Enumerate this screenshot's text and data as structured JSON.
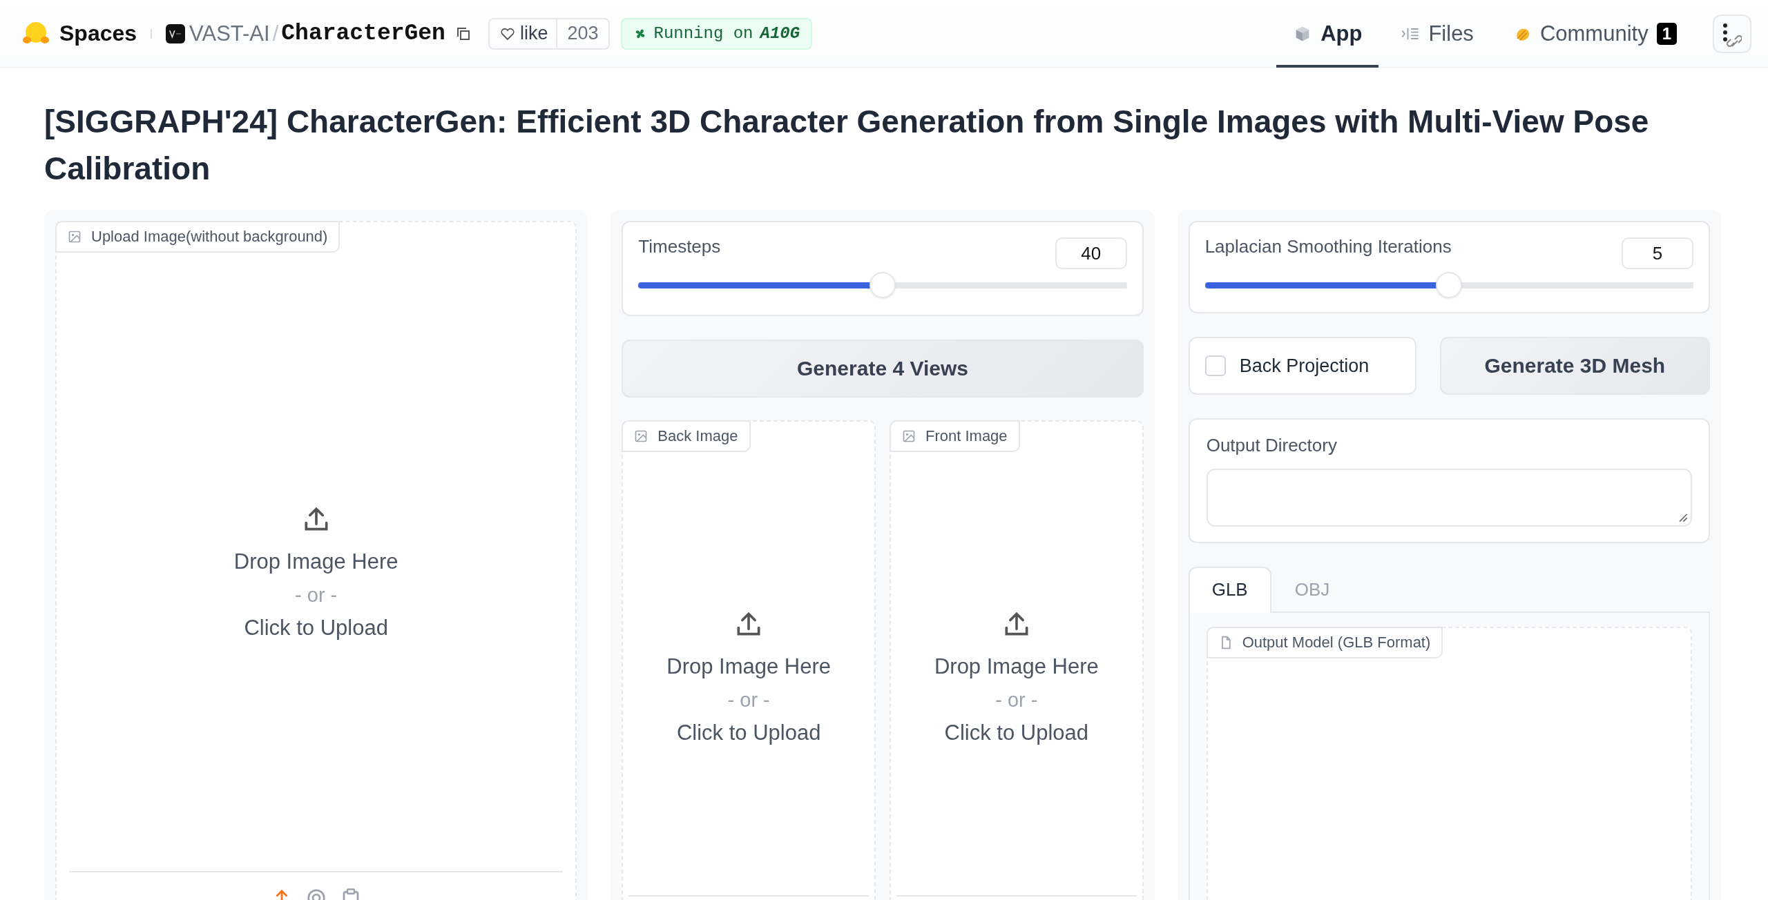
{
  "header": {
    "brand": "Spaces",
    "owner": "VAST-AI",
    "separator": "/",
    "repo": "CharacterGen",
    "like": {
      "label": "like",
      "count": "203"
    },
    "status": {
      "text": "Running on",
      "hardware": "A10G"
    },
    "nav": [
      {
        "label": "App",
        "selected": true
      },
      {
        "label": "Files",
        "selected": false
      },
      {
        "label": "Community",
        "selected": false,
        "badge": "1"
      }
    ]
  },
  "title": "[SIGGRAPH'24] CharacterGen: Efficient 3D Character Generation from Single Images with Multi-View Pose Calibration",
  "left": {
    "upload": {
      "label": "Upload Image(without background)",
      "drop": "Drop Image Here",
      "or": "- or -",
      "click": "Click to Upload"
    },
    "sources": [
      {
        "selected": true
      },
      {
        "selected": false
      },
      {
        "selected": false
      }
    ]
  },
  "middle": {
    "slider": {
      "label": "Timesteps",
      "value": "40",
      "level": 0.5
    },
    "button": "Generate 4 Views",
    "uploads": [
      {
        "label": "Back Image",
        "drop": "Drop Image Here",
        "or": "- or -",
        "click": "Click to Upload"
      },
      {
        "label": "Front Image",
        "drop": "Drop Image Here",
        "or": "- or -",
        "click": "Click to Upload"
      }
    ]
  },
  "right": {
    "slider": {
      "label": "Laplacian Smoothing Iterations",
      "value": "5",
      "level": 0.5
    },
    "checkbox": {
      "label": "Back Projection",
      "checked": false
    },
    "button": "Generate 3D Mesh",
    "output_directory": {
      "label": "Output Directory"
    },
    "tabs": [
      {
        "label": "GLB",
        "selected": true
      },
      {
        "label": "OBJ",
        "selected": false
      }
    ],
    "model": {
      "label": "Output Model (GLB Format)"
    }
  }
}
